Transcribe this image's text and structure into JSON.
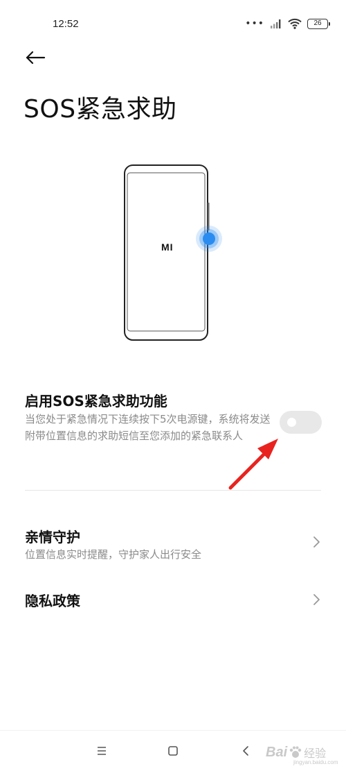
{
  "status_bar": {
    "time": "12:52",
    "dots": "•••",
    "battery": "26"
  },
  "header": {
    "title": "SOS紧急求助"
  },
  "illustration": {
    "logo": "MI",
    "accent_color": "#2a8cf0"
  },
  "sos_setting": {
    "title": "启用SOS紧急求助功能",
    "description": "当您处于紧急情况下连续按下5次电源键，系统将发送附带位置信息的求助短信至您添加的紧急联系人",
    "enabled": false,
    "annotation_color": "#e8231f"
  },
  "rows": [
    {
      "title": "亲情守护",
      "subtitle": "位置信息实时提醒，守护家人出行安全",
      "icon": "chevron-right-icon"
    },
    {
      "title": "隐私政策",
      "icon": "chevron-right-icon"
    }
  ],
  "nav": {
    "icons": [
      "menu-icon",
      "home-icon",
      "back-icon"
    ]
  },
  "watermark": {
    "brand": "Bai",
    "cn": "经验",
    "sub": "jingyan.baidu.com"
  }
}
